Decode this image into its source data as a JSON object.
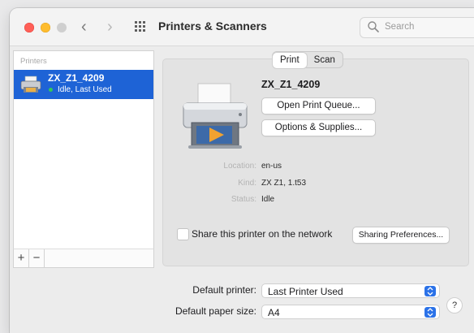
{
  "window": {
    "title": "Printers & Scanners",
    "search_placeholder": "Search"
  },
  "sidebar": {
    "header": "Printers",
    "printers": [
      {
        "name": "ZX_Z1_4209",
        "status": "Idle, Last Used"
      }
    ],
    "add_label": "+",
    "remove_label": "−"
  },
  "tabs": [
    {
      "label": "Print",
      "selected": true
    },
    {
      "label": "Scan",
      "selected": false
    }
  ],
  "detail": {
    "printer_name": "ZX_Z1_4209",
    "open_queue_label": "Open Print Queue...",
    "options_supplies_label": "Options & Supplies...",
    "location_label": "Location:",
    "location_value": "en-us",
    "kind_label": "Kind:",
    "kind_value": "ZX Z1, 1.t53",
    "status_label": "Status:",
    "status_value": "Idle",
    "share_label": "Share this printer on the network",
    "sharing_prefs_label": "Sharing Preferences..."
  },
  "defaults": {
    "printer_label": "Default printer:",
    "printer_value": "Last Printer Used",
    "paper_label": "Default paper size:",
    "paper_value": "A4"
  },
  "help_label": "?",
  "colors": {
    "selection": "#1e63d6",
    "accent": "#2b72e8",
    "status_dot": "#34c759"
  }
}
